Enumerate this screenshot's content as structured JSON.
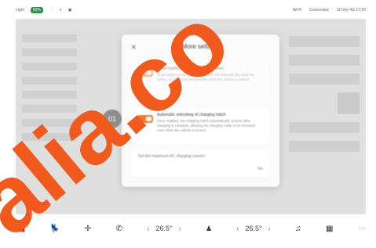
{
  "statusbar": {
    "left_items": [
      "Light",
      "90%",
      "⋮",
      "≡",
      "▣"
    ],
    "right_items": [
      "Wi-Fi",
      "Connected",
      "11 Nov 4G 17:55"
    ]
  },
  "modal": {
    "close_icon": "close-icon",
    "title": "More settings",
    "settings": [
      {
        "title": "Smart battery temperature regulation",
        "description": "Smart battery temperature regulation will automatically keep the battery at an optimal temperature while the vehicle is parked."
      },
      {
        "title": "Automatic unlocking of charging hatch",
        "description": "Once enabled, the charging hatch automatically unlocks after charging is complete, allowing the charging cable to be removed even when the vehicle is locked."
      }
    ],
    "current_row": {
      "label": "Set the maximum AC charging current",
      "unit": "%o"
    }
  },
  "badge": "01",
  "taskbar": {
    "left_temp": "26.5°",
    "right_temp": "26.5°",
    "icons": [
      "car-icon",
      "seat-icon",
      "fan-icon",
      "phone-icon",
      "person-icon",
      "music-icon",
      "apps-icon"
    ]
  },
  "watermark": {
    "text": "alia.co",
    "color": "#f15a1c"
  }
}
